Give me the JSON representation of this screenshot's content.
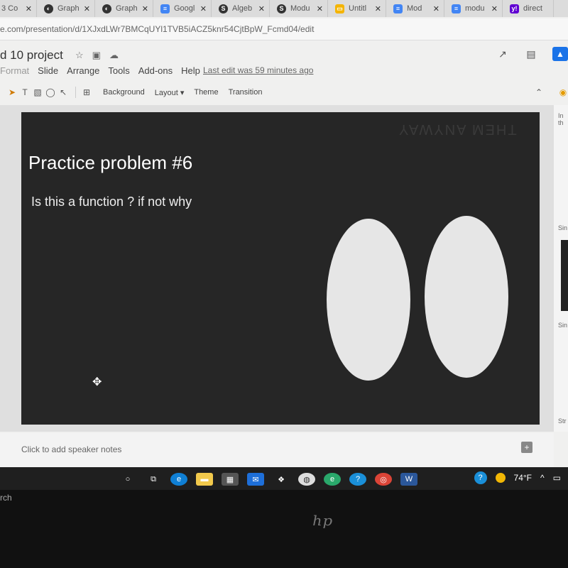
{
  "browser": {
    "tabs": [
      {
        "title": "3 Co",
        "icon": "doc-icon",
        "color": "#4a6ad8"
      },
      {
        "title": "Graph",
        "icon": "desmos-icon",
        "color": "#333333"
      },
      {
        "title": "Graph",
        "icon": "desmos-icon",
        "color": "#333333"
      },
      {
        "title": "Googl",
        "icon": "google-docs-icon",
        "color": "#4285f4"
      },
      {
        "title": "Algeb",
        "icon": "s-icon",
        "color": "#333333"
      },
      {
        "title": "Modu",
        "icon": "s-icon",
        "color": "#333333"
      },
      {
        "title": "Untitl",
        "icon": "slides-icon",
        "color": "#f4b400"
      },
      {
        "title": "Mod",
        "icon": "google-docs-icon",
        "color": "#4285f4"
      },
      {
        "title": "modu",
        "icon": "google-docs-icon",
        "color": "#4285f4"
      },
      {
        "title": "direct",
        "icon": "yahoo-icon",
        "color": "#6001d2"
      }
    ],
    "url": "e.com/presentation/d/1XJxdLWr7BMCqUYl1TVB5iACZ5knr54CjtBpW_Fcmd04/edit"
  },
  "doc": {
    "title": "d 10 project",
    "menu": [
      "Format",
      "Slide",
      "Arrange",
      "Tools",
      "Add-ons",
      "Help"
    ],
    "last_edit": "Last edit was 59 minutes ago"
  },
  "toolbar": {
    "background": "Background",
    "layout": "Layout",
    "theme": "Theme",
    "transition": "Transition"
  },
  "slide": {
    "ghost_text": "THEM ANYWAY",
    "title": "Practice problem #6",
    "subtitle": "Is this a function ? if not why"
  },
  "side_panel": {
    "labels": [
      "In th",
      "Sin",
      "Sin",
      "Str"
    ]
  },
  "notes": {
    "placeholder": "Click to add speaker notes"
  },
  "taskbar": {
    "search": "rch",
    "temperature": "74°F"
  },
  "colors": {
    "slide_bg": "#262626",
    "oval_fill": "#e6e6e6",
    "accent_blue": "#1a73e8"
  }
}
